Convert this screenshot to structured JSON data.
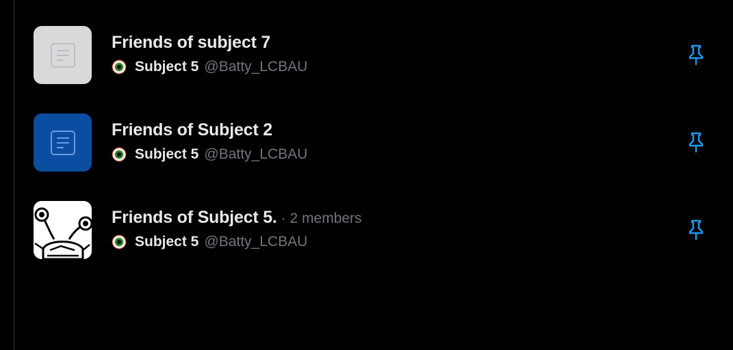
{
  "lists": [
    {
      "title": "Friends of subject 7",
      "members": "",
      "owner_name": "Subject 5",
      "owner_handle": "@Batty_LCBAU",
      "thumb_style": "gray",
      "thumb_icon": "list-document-icon"
    },
    {
      "title": "Friends of Subject 2",
      "members": "",
      "owner_name": "Subject 5",
      "owner_handle": "@Batty_LCBAU",
      "thumb_style": "blue",
      "thumb_icon": "list-document-icon"
    },
    {
      "title": "Friends of Subject 5.",
      "members": "· 2 members",
      "owner_name": "Subject 5",
      "owner_handle": "@Batty_LCBAU",
      "thumb_style": "art",
      "thumb_icon": "drawing-image"
    }
  ],
  "colors": {
    "background": "#000000",
    "text_primary": "#e7e9ea",
    "text_secondary": "#71767b",
    "accent": "#1d9bf0",
    "thumb_gray": "#d9d9d9",
    "thumb_blue": "#0b4da0"
  },
  "icons": {
    "pin": "pin-icon",
    "owner_avatar": "eyeball-avatar"
  }
}
